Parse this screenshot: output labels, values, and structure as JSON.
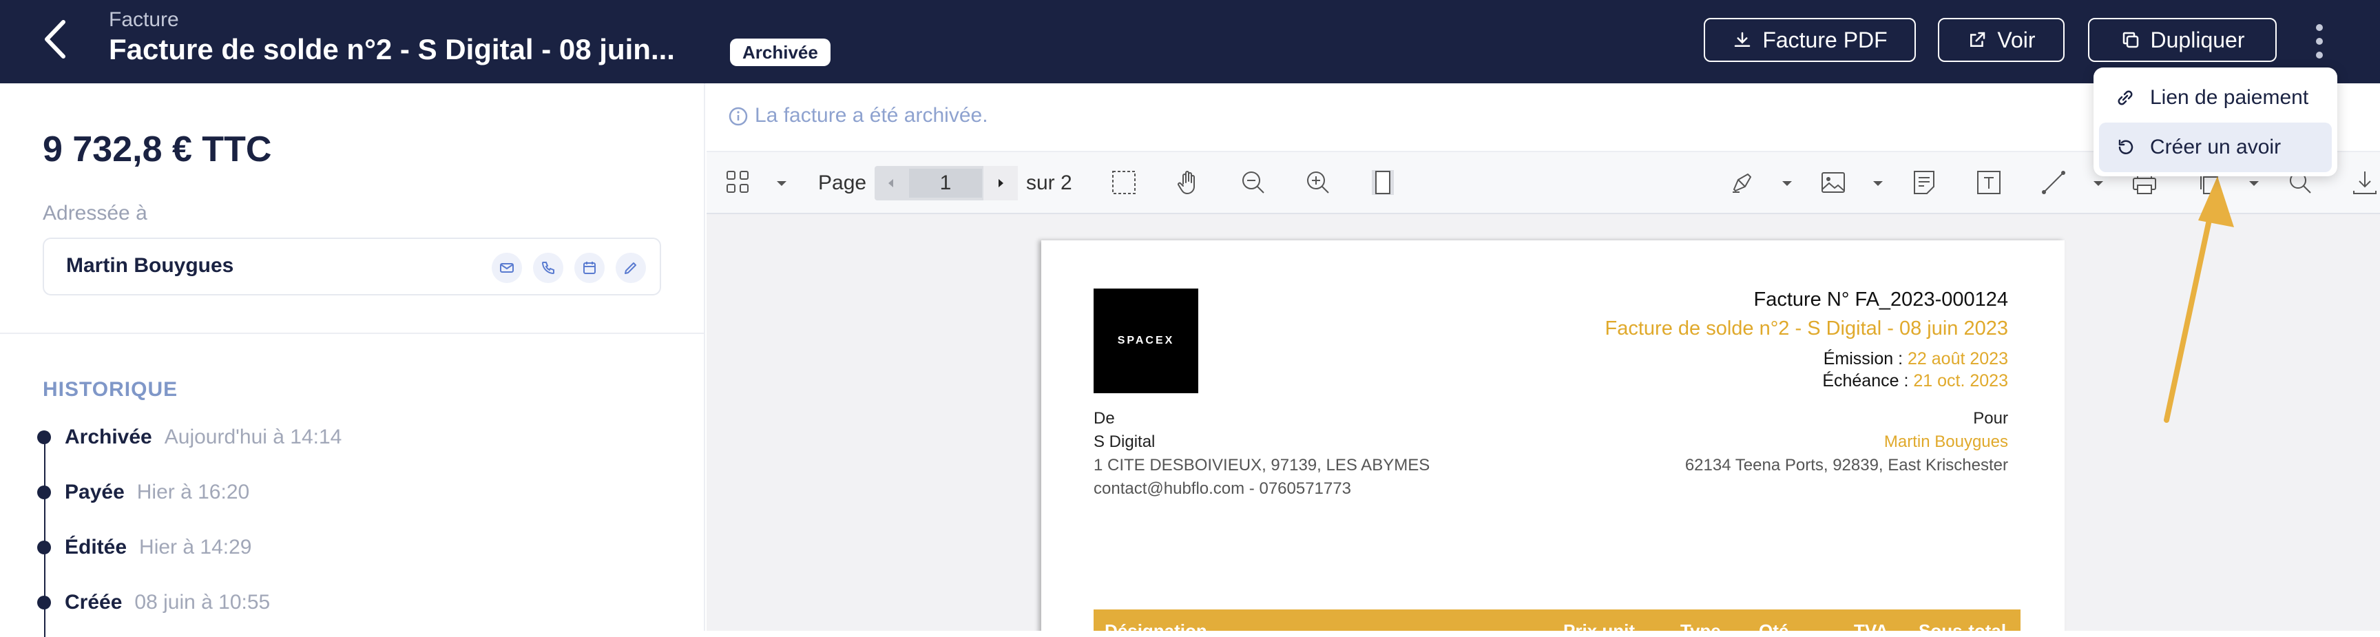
{
  "header": {
    "label": "Facture",
    "title": "Facture de solde n°2 - S Digital - 08 juin...",
    "badge": "Archivée",
    "buttons": {
      "pdf": "Facture PDF",
      "view": "Voir",
      "duplicate": "Dupliquer"
    },
    "colors": {
      "bg": "#1a2242"
    }
  },
  "dropdown": {
    "items": [
      {
        "label": "Lien de paiement",
        "icon": "link-icon"
      },
      {
        "label": "Créer un avoir",
        "icon": "undo-icon"
      }
    ]
  },
  "summary": {
    "amount": "9 732,8 € TTC",
    "addressed_to_label": "Adressée à",
    "contact_name": "Martin Bouygues"
  },
  "history": {
    "title": "HISTORIQUE",
    "items": [
      {
        "status": "Archivée",
        "time": "Aujourd'hui à 14:14"
      },
      {
        "status": "Payée",
        "time": "Hier à 16:20"
      },
      {
        "status": "Éditée",
        "time": "Hier à 14:29"
      },
      {
        "status": "Créée",
        "time": "08 juin à 10:55"
      }
    ]
  },
  "notice": "La facture a été archivée.",
  "viewer": {
    "page_label": "Page",
    "current_page": "1",
    "of_label": "sur 2"
  },
  "document": {
    "logo_text": "SPACEX",
    "invoice_no": "Facture N° FA_2023-000124",
    "title": "Facture de solde n°2 - S Digital - 08 juin 2023",
    "emission_label": "Émission :",
    "emission_date": "22 août 2023",
    "due_label": "Échéance :",
    "due_date": "21 oct. 2023",
    "from": {
      "label": "De",
      "name": "S Digital",
      "address": "1 CITE DESBOIVIEUX, 97139, LES ABYMES",
      "contact": "contact@hubflo.com - 0760571773"
    },
    "to": {
      "label": "Pour",
      "name": "Martin Bouygues",
      "address": "62134 Teena Ports, 92839, East Krischester"
    },
    "table_headers": [
      "Désignation",
      "Prix unit.",
      "Type",
      "Qté",
      "TVA",
      "Sous-total"
    ],
    "accent": "#e0a92b"
  }
}
